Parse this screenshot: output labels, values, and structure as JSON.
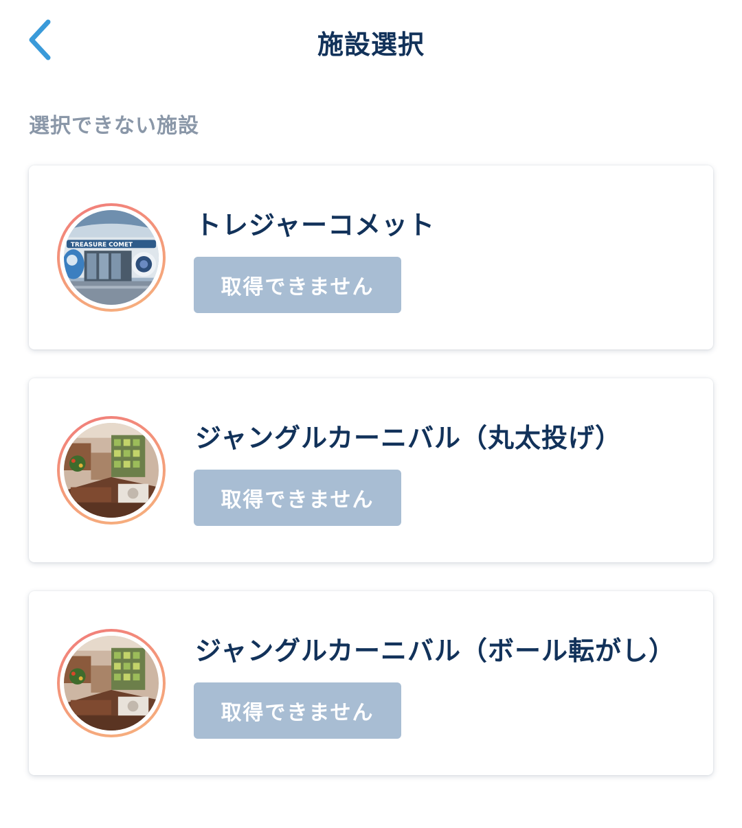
{
  "header": {
    "title": "施設選択",
    "back_icon": "chevron-left-icon",
    "accent_color": "#3a9ad9"
  },
  "section": {
    "label": "選択できない施設"
  },
  "facilities": [
    {
      "name": "トレジャーコメット",
      "button_label": "取得できません",
      "image": "treasure-comet-storefront",
      "image_sign_text": "TREASURE COMET"
    },
    {
      "name": "ジャングルカーニバル（丸太投げ）",
      "button_label": "取得できません",
      "image": "jungle-carnival-booth"
    },
    {
      "name": "ジャングルカーニバル（ボール転がし）",
      "button_label": "取得できません",
      "image": "jungle-carnival-booth"
    }
  ],
  "colors": {
    "title": "#12325a",
    "section_label": "#8a97a8",
    "disabled_button": "#a8bdd3",
    "avatar_ring": "#f07a7a"
  }
}
